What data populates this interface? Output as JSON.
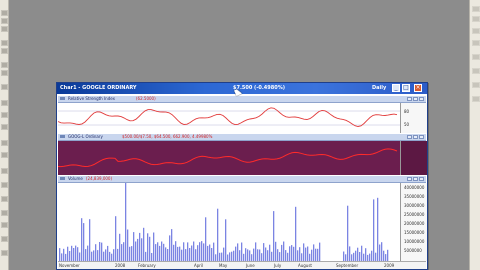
{
  "window": {
    "title": "Char1 - GOOGLE ORDINARY",
    "price_readout": "$7.500 (-0.4980%)",
    "period": "Daily",
    "colors": {
      "titlebar": "#2d68d4",
      "header": "#c9d6ee",
      "value_text": "#d41f1f"
    }
  },
  "panels": {
    "rsi": {
      "name": "Relative Strength Index",
      "value": "(62.5000)",
      "axis_labels": [
        "80",
        "50"
      ],
      "line_color": "#e23c3c"
    },
    "price": {
      "name": "GOOG-L Ordinary",
      "value": "$500.00/$7.50, $64.500, 662.900, 4.49980%",
      "line_color": "#ff2a2a",
      "background": "#6b1e4e"
    },
    "volume": {
      "name": "Volume",
      "value": "(24,839,000)",
      "axis_labels": [
        "40000000",
        "35000000",
        "30000000",
        "25000000",
        "20000000",
        "15000000",
        "10000000",
        "5000000"
      ],
      "bar_color": "#7b84e3"
    }
  },
  "date_axis": [
    "November",
    "2008",
    "February",
    "April",
    "May",
    "June",
    "July",
    "August",
    "September",
    "2009"
  ],
  "icons": {
    "minimize": "minimize-icon",
    "maximize": "maximize-icon",
    "close": "close-icon"
  }
}
